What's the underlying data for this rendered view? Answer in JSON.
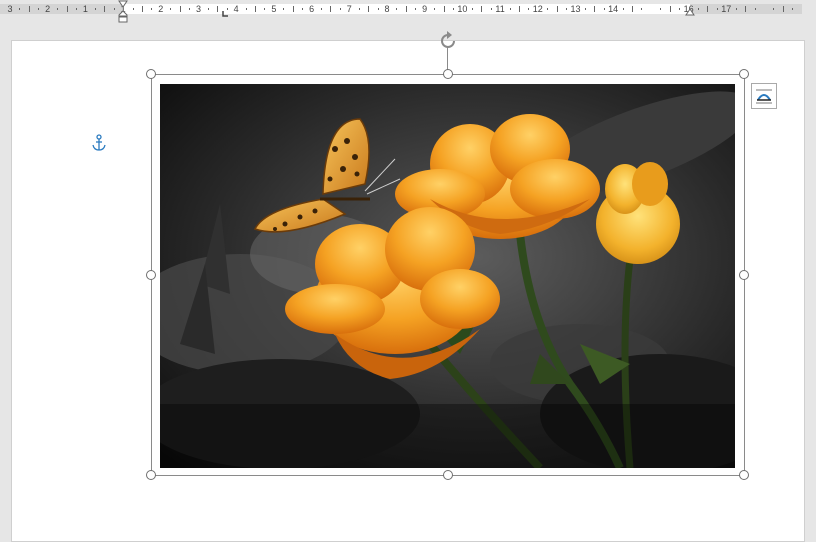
{
  "ruler": {
    "numbers": [
      "3",
      "2",
      "1",
      "1",
      "2",
      "3",
      "4",
      "5",
      "6",
      "7",
      "8",
      "9",
      "10",
      "11",
      "12",
      "13",
      "14",
      "16",
      "17"
    ]
  },
  "document": {
    "image": {
      "description_icon": "picture-icon"
    }
  },
  "colors": {
    "ruler_bg": "#d4d4d4",
    "page_bg": "#ffffff",
    "anchor": "#2b7bc0",
    "handle_border": "#6e6e6e",
    "petal_orange": "#f5a223",
    "butterfly": "#e8a43a"
  }
}
